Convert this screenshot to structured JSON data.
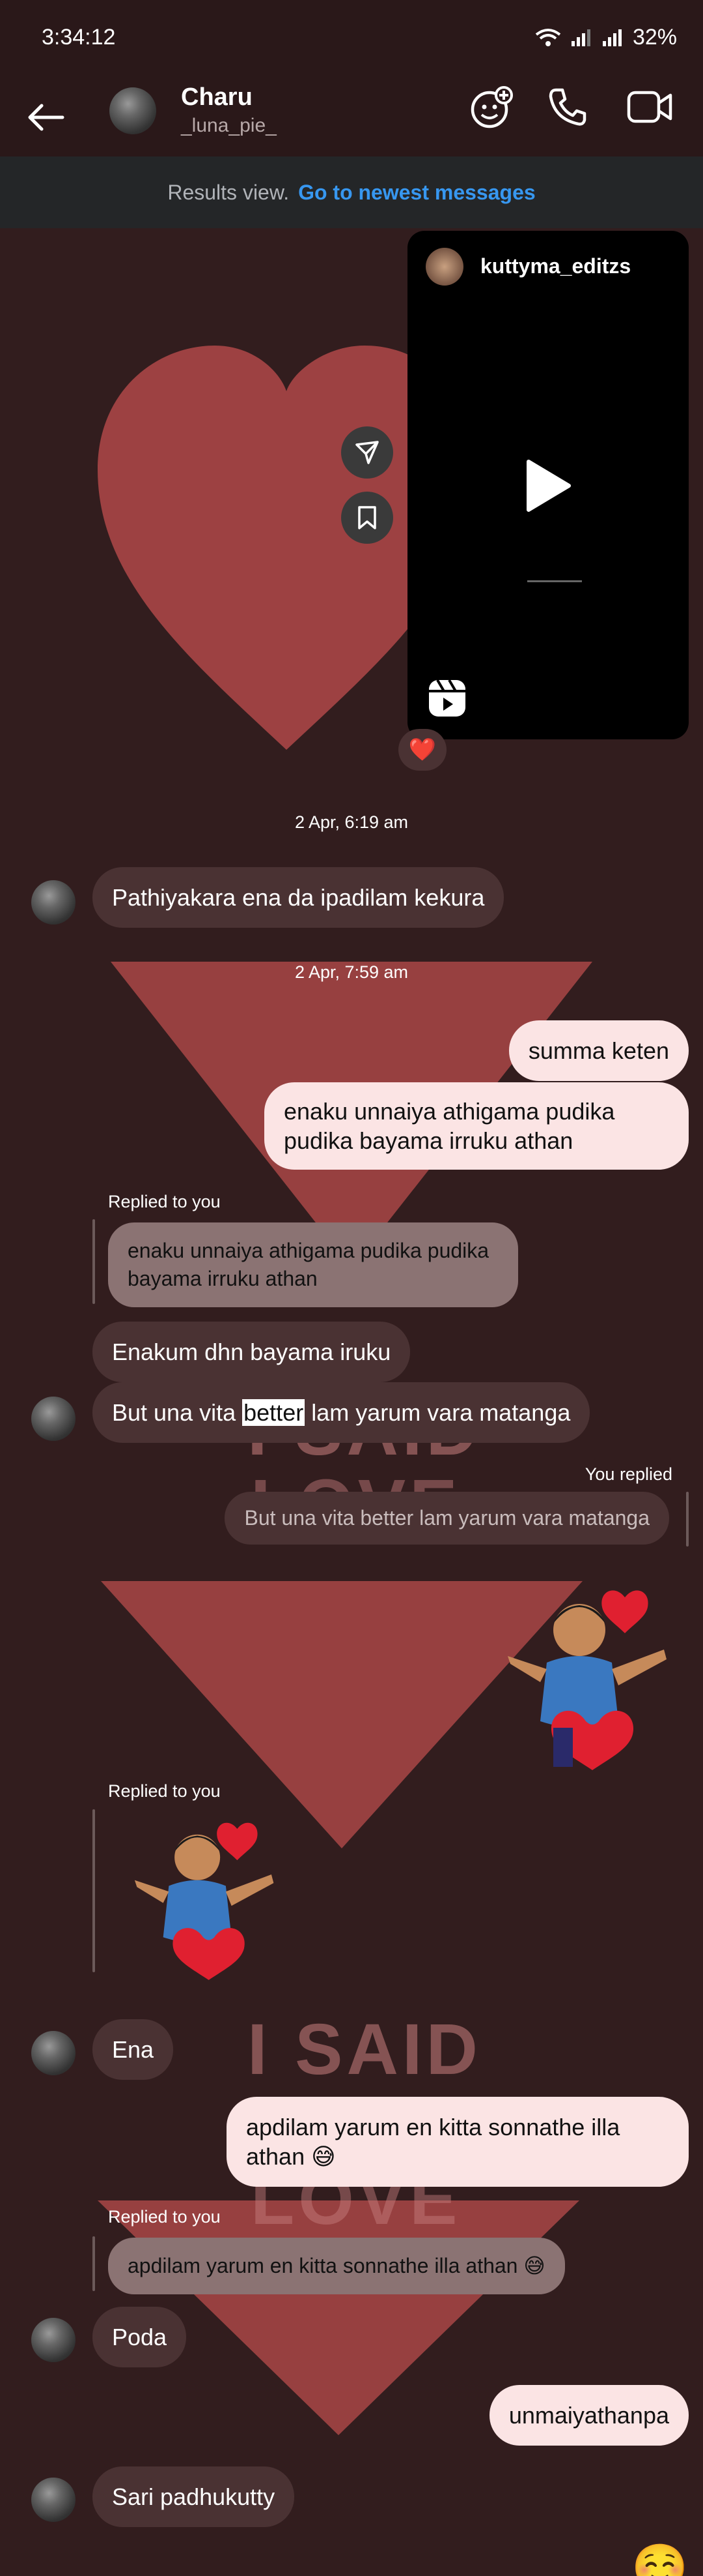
{
  "status_bar": {
    "time": "3:34:12",
    "battery": "32%"
  },
  "header": {
    "name": "Charu",
    "username": "_luna_pie_"
  },
  "results_bar": {
    "text": "Results view.",
    "link": "Go to newest messages"
  },
  "reel": {
    "account": "kuttyma_editzs",
    "reaction": "❤️"
  },
  "timestamps": [
    "2 Apr, 6:19 am",
    "2 Apr, 7:59 am"
  ],
  "messages": {
    "m1": "Pathiyakara ena da ipadilam kekura",
    "m2": "summa keten",
    "m3": "enaku unnaiya athigama pudika pudika bayama irruku athan",
    "m3_quote": "enaku unnaiya athigama pudika pudika bayama irruku athan",
    "m4": "Enakum dhn bayama iruku",
    "m5_a": "But una vita ",
    "m5_sel": "better",
    "m5_b": " lam yarum vara matanga",
    "m5_quote": "But una vita better lam yarum vara matanga",
    "m6": "Ena",
    "m7": "apdilam yarum en kitta sonnathe illa athan 😅",
    "m7_quote": "apdilam yarum en kitta sonnathe illa athan 😅",
    "m8": "Poda",
    "m9": "unmaiyathanpa",
    "m10": "Sari padhukutty",
    "m11": "☺️"
  },
  "labels": {
    "replied_to_you": "Replied to you",
    "you_replied": "You replied",
    "wall_text_1": "I SAID",
    "wall_text_2": "LOVE"
  },
  "colors": {
    "accent": "#3797f0",
    "bubble_out": "#fbe4e4",
    "bubble_in": "#4a3233",
    "heart": "#a94646"
  }
}
